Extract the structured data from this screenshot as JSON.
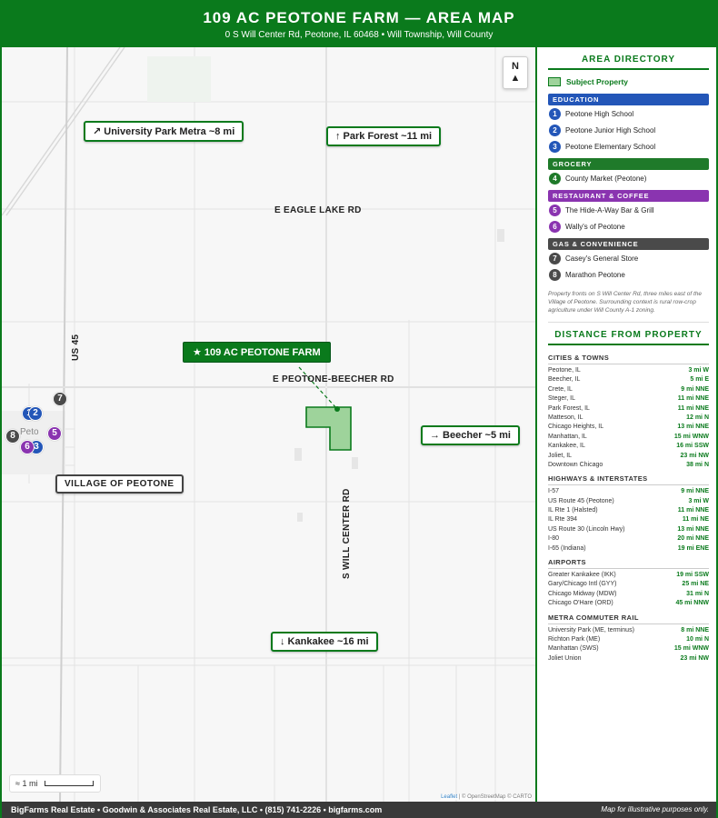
{
  "header": {
    "title": "109 AC PEOTONE FARM — AREA MAP",
    "subtitle": "0 S Will Center Rd, Peotone, IL 60468 • Will Township, Will County"
  },
  "map": {
    "north_label": "N",
    "north_arrow": "▲",
    "roads": {
      "eagle_lake": "E EAGLE LAKE RD",
      "peotone_beecher": "E PEOTONE-BEECHER RD",
      "will_center": "S WILL CENTER RD",
      "us45": "US 45"
    },
    "callouts": {
      "university_park": "↗ University Park Metra ~8 mi",
      "park_forest": "↑ Park Forest ~11 mi",
      "beecher": "→ Beecher ~5 mi",
      "kankakee": "↓ Kankakee ~16 mi",
      "village": "VILLAGE OF PEOTONE"
    },
    "farm_label": "★ 109 AC PEOTONE FARM",
    "town_faint": "Peto",
    "scale_label": "≈ 1 mi",
    "attribution_leaflet": "Leaflet",
    "attribution_rest": "| © OpenStreetMap © CARTO",
    "markers": [
      "1",
      "2",
      "3",
      "4",
      "5",
      "6",
      "7",
      "8"
    ]
  },
  "sidebar": {
    "directory_title": "AREA DIRECTORY",
    "legend_label": "Subject Property",
    "categories": [
      {
        "title": "EDUCATION",
        "color": "#2356b8",
        "items": [
          {
            "num": "1",
            "name": "Peotone High School"
          },
          {
            "num": "2",
            "name": "Peotone Junior High School"
          },
          {
            "num": "3",
            "name": "Peotone Elementary School"
          }
        ]
      },
      {
        "title": "GROCERY",
        "color": "#1f7a2a",
        "items": [
          {
            "num": "4",
            "name": "County Market (Peotone)"
          }
        ]
      },
      {
        "title": "RESTAURANT & COFFEE",
        "color": "#8a34b0",
        "items": [
          {
            "num": "5",
            "name": "The Hide-A-Way Bar & Grill"
          },
          {
            "num": "6",
            "name": "Wally's of Peotone"
          }
        ]
      },
      {
        "title": "GAS & CONVENIENCE",
        "color": "#4a4a4a",
        "items": [
          {
            "num": "7",
            "name": "Casey's General Store"
          },
          {
            "num": "8",
            "name": "Marathon Peotone"
          }
        ]
      }
    ],
    "note": "Property fronts on S Will Center Rd, three miles east of the Village of Peotone. Surrounding context is rural row-crop agriculture under Will County A-1 zoning.",
    "distance_title": "DISTANCE FROM PROPERTY",
    "groups": [
      {
        "title": "CITIES & TOWNS",
        "rows": [
          [
            "Peotone, IL",
            "3 mi W"
          ],
          [
            "Beecher, IL",
            "5 mi E"
          ],
          [
            "Crete, IL",
            "9 mi NNE"
          ],
          [
            "Steger, IL",
            "11 mi NNE"
          ],
          [
            "Park Forest, IL",
            "11 mi NNE"
          ],
          [
            "Matteson, IL",
            "12 mi N"
          ],
          [
            "Chicago Heights, IL",
            "13 mi NNE"
          ],
          [
            "Manhattan, IL",
            "15 mi WNW"
          ],
          [
            "Kankakee, IL",
            "16 mi SSW"
          ],
          [
            "Joliet, IL",
            "23 mi NW"
          ],
          [
            "Downtown Chicago",
            "38 mi N"
          ]
        ]
      },
      {
        "title": "HIGHWAYS & INTERSTATES",
        "rows": [
          [
            "I-57",
            "9 mi NNE"
          ],
          [
            "US Route 45 (Peotone)",
            "3 mi W"
          ],
          [
            "IL Rte 1 (Halsted)",
            "11 mi NNE"
          ],
          [
            "IL Rte 394",
            "11 mi NE"
          ],
          [
            "US Route 30 (Lincoln Hwy)",
            "13 mi NNE"
          ],
          [
            "I-80",
            "20 mi NNE"
          ],
          [
            "I-65 (Indiana)",
            "19 mi ENE"
          ]
        ]
      },
      {
        "title": "AIRPORTS",
        "rows": [
          [
            "Greater Kankakee (IKK)",
            "19 mi SSW"
          ],
          [
            "Gary/Chicago Intl (GYY)",
            "25 mi NE"
          ],
          [
            "Chicago Midway (MDW)",
            "31 mi N"
          ],
          [
            "Chicago O'Hare (ORD)",
            "45 mi NNW"
          ]
        ]
      },
      {
        "title": "METRA COMMUTER RAIL",
        "rows": [
          [
            "University Park (ME, terminus)",
            "8 mi NNE"
          ],
          [
            "Richton Park (ME)",
            "10 mi N"
          ],
          [
            "Manhattan (SWS)",
            "15 mi WNW"
          ],
          [
            "Joliet Union",
            "23 mi NW"
          ]
        ]
      }
    ]
  },
  "footer": {
    "left": "BigFarms Real Estate • Goodwin & Associates Real Estate, LLC • (815) 741-2226 • bigfarms.com",
    "right": "Map for illustrative purposes only."
  },
  "colors": {
    "brand_green": "#0a7a1c",
    "property_fill": "#9ed39b",
    "education": "#2356b8",
    "grocery": "#1f7a2a",
    "restaurant": "#8a34b0",
    "gas": "#4a4a4a"
  }
}
